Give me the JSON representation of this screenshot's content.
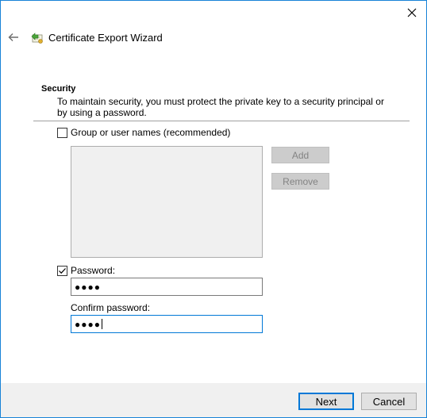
{
  "window": {
    "title": "Certificate Export Wizard",
    "accent_color": "#1883d7",
    "close_icon": "close-icon",
    "back_icon": "back-arrow-icon",
    "wizard_icon": "certificate-icon"
  },
  "section": {
    "title": "Security",
    "description": "To maintain security, you must protect the private key to a security principal or by using a password."
  },
  "group_option": {
    "label": "Group or user names (recommended)",
    "checked": false,
    "add_label": "Add",
    "remove_label": "Remove"
  },
  "password_option": {
    "label": "Password:",
    "checked": true,
    "value": "●●●●"
  },
  "confirm_password": {
    "label": "Confirm password:",
    "value": "●●●●"
  },
  "footer": {
    "next_label": "Next",
    "cancel_label": "Cancel"
  }
}
